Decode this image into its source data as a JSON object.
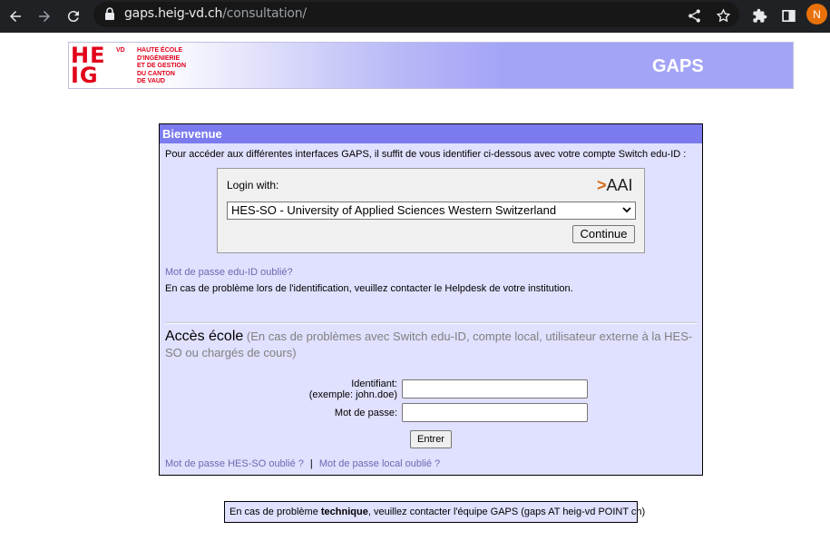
{
  "browser": {
    "url_host": "gaps.heig-vd.ch",
    "url_path": "/consultation/",
    "profile_initial": "N"
  },
  "banner": {
    "logo_he": "HE",
    "logo_ig": "IG",
    "logo_vd": "VD",
    "logo_lines": [
      "HAUTE ÉCOLE",
      "D'INGÉNIERIE",
      "ET DE GESTION",
      "DU CANTON",
      "DE VAUD"
    ],
    "title": "GAPS"
  },
  "panel": {
    "header": "Bienvenue",
    "intro": "Pour accéder aux différentes interfaces GAPS, il suffit de vous identifier ci-dessous avec votre compte Switch edu-ID :",
    "login_with": "Login with:",
    "aai_logo": "AAI",
    "org_selected": "HES-SO - University of Applied Sciences Western Switzerland",
    "continue": "Continue",
    "pw_forgot": "Mot de passe edu-ID oublié?",
    "helpdesk": "En cas de problème lors de l'identification, veuillez contacter le Helpdesk de votre institution.",
    "ecole_head": "Accès école",
    "ecole_note": "(En cas de problèmes avec Switch edu-ID, compte local, utilisateur externe à la HES-SO ou chargés de cours)",
    "id_label": "Identifiant:",
    "id_example": "(exemple: john.doe)",
    "pw_label": "Mot de passe:",
    "enter": "Entrer",
    "hesso_pw_forgot": "Mot de passe HES-SO oublié ?",
    "separator": "|",
    "local_pw_forgot": "Mot de passe local oublié ?"
  },
  "footer": {
    "prefix": "En cas de problème ",
    "bold": "technique",
    "suffix": ", veuillez contacter l'équipe GAPS (gaps AT heig-vd POINT ch)"
  },
  "colors": {
    "header": "#7b7bef",
    "panel_bg": "#e0e0ff",
    "logo_red": "#e2001a",
    "link": "#6a6ab0"
  }
}
